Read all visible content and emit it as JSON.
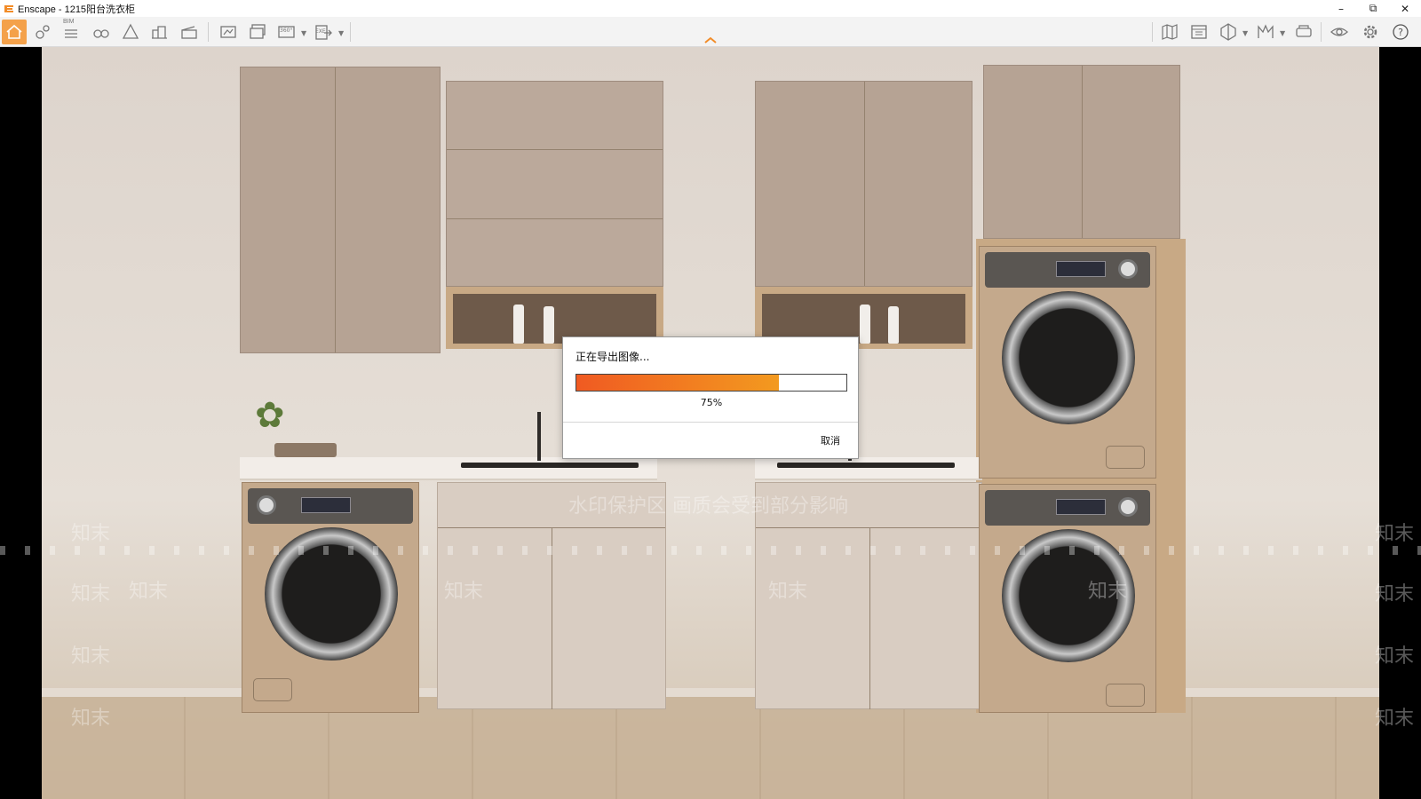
{
  "window": {
    "app_logo": "enscape-logo-icon",
    "title": "Enscape - 1215阳台洗衣柜",
    "controls": [
      "minimize-icon",
      "restore-icon",
      "close-icon"
    ]
  },
  "toolbar": {
    "bim_label": "BIM",
    "left_icons": [
      "home-icon",
      "map-pin-icon",
      "bim-list-icon",
      "binoculars-icon",
      "asset-library-icon",
      "buildings-icon",
      "clapper-icon",
      "screenshot-icon",
      "batch-render-icon",
      "panorama-icon",
      "export-icon"
    ],
    "panorama_label": "360°",
    "export_label": "EXE",
    "right_icons": [
      "map-icon",
      "material-editor-icon",
      "section-icon",
      "atmosphere-icon",
      "vr-headset-icon",
      "visual-settings-icon",
      "settings-gear-icon",
      "help-icon"
    ],
    "accent": "#f4a14a"
  },
  "render_watermark": {
    "line": "水印保护区   画质会受到部分影响",
    "brand": "知末"
  },
  "dialog": {
    "title": "正在导出图像...",
    "progress": 0.75,
    "percent_label": "75%",
    "cancel_label": "取消",
    "progress_color_start": "#f05a22",
    "progress_color_end": "#f39a1f"
  }
}
